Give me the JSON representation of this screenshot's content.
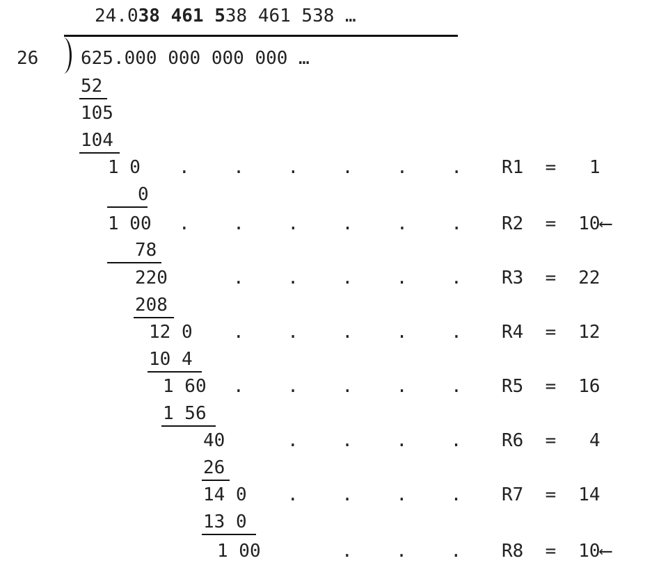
{
  "division": {
    "divisor": "26",
    "dividend": "625.000 000 000 000 …",
    "quotient": {
      "lead": "24.0",
      "bold_1": "38 461 5",
      "tail": "38 461 538 …"
    },
    "work": {
      "r_52": "52",
      "r_105": "105",
      "r_104": "104",
      "r_1_0": "1 0",
      "r_0": "0",
      "r_1_00": "1 00",
      "r_78": "78",
      "r_220": "220",
      "r_208": "208",
      "r_12_0": "12 0",
      "r_10_4": "10 4",
      "r_1_60": "1 60",
      "r_1_56": "1 56",
      "r_40": "40",
      "r_26": "26",
      "r_14_0": "14 0",
      "r_13_0": "13 0",
      "r_1_00b": "1 00"
    },
    "leaders": {
      "row1": ".    .    .    .    .    .",
      "row2": ".    .    .    .    .    .",
      "row3": ".    .    .    .    .",
      "row4": ".    .    .    .    .",
      "row5": ".    .    .    .    .",
      "row6": ".    .    .    .",
      "row7": ".    .    .    .",
      "row8": ".    .    ."
    },
    "remainders": [
      {
        "label": "R1",
        "eq": "=",
        "value": "1",
        "arrow": ""
      },
      {
        "label": "R2",
        "eq": "=",
        "value": "10",
        "arrow": "⟵"
      },
      {
        "label": "R3",
        "eq": "=",
        "value": "22",
        "arrow": ""
      },
      {
        "label": "R4",
        "eq": "=",
        "value": "12",
        "arrow": ""
      },
      {
        "label": "R5",
        "eq": "=",
        "value": "16",
        "arrow": ""
      },
      {
        "label": "R6",
        "eq": "=",
        "value": "4",
        "arrow": ""
      },
      {
        "label": "R7",
        "eq": "=",
        "value": "14",
        "arrow": ""
      },
      {
        "label": "R8",
        "eq": "=",
        "value": "10",
        "arrow": "⟵"
      }
    ]
  }
}
